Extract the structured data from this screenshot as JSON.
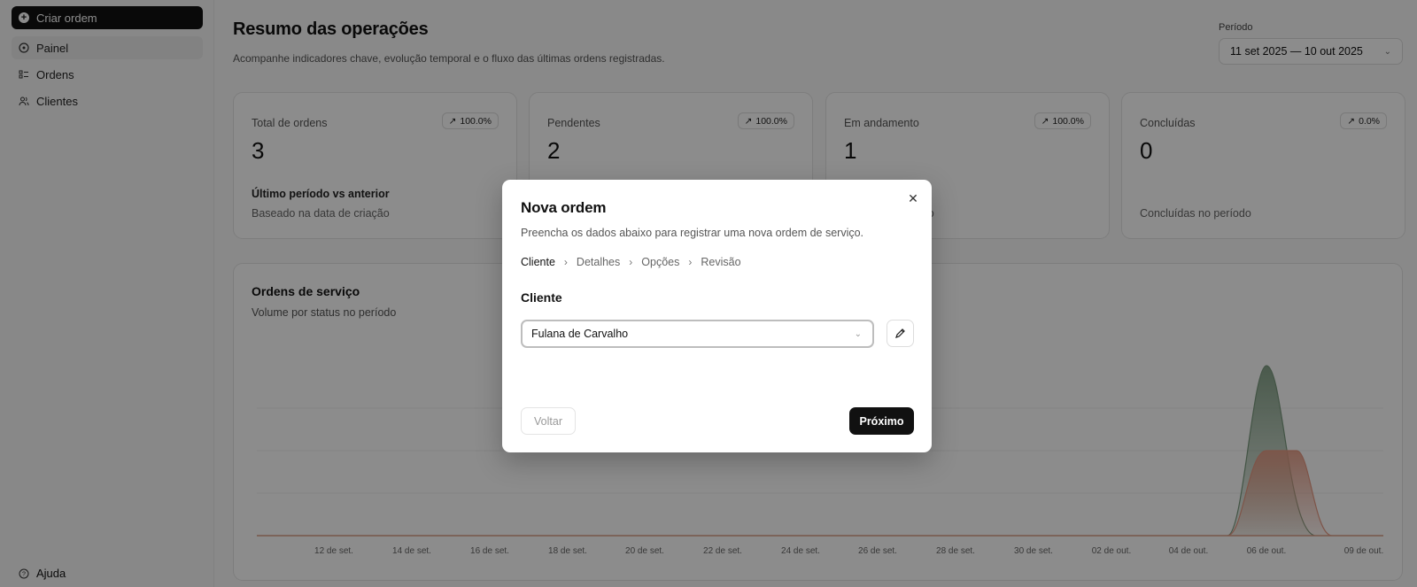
{
  "sidebar": {
    "create_label": "Criar ordem",
    "items": [
      {
        "label": "Painel",
        "icon": "dashboard-icon"
      },
      {
        "label": "Ordens",
        "icon": "list-icon"
      },
      {
        "label": "Clientes",
        "icon": "users-icon"
      }
    ],
    "help_label": "Ajuda"
  },
  "header": {
    "title": "Resumo das operações",
    "subtitle": "Acompanhe indicadores chave, evolução temporal e o fluxo das últimas ordens registradas.",
    "period_label": "Período",
    "period_value": "11 set 2025 — 10 out 2025"
  },
  "cards": [
    {
      "label": "Total de ordens",
      "value": "3",
      "badge": "100.0%",
      "foot1": "Último período vs anterior",
      "foot2": "Baseado na data de criação"
    },
    {
      "label": "Pendentes",
      "value": "2",
      "badge": "100.0%",
      "foot1": "",
      "foot2": ""
    },
    {
      "label": "Em andamento",
      "value": "1",
      "badge": "100.0%",
      "foot1": "",
      "foot2": "amento"
    },
    {
      "label": "Concluídas",
      "value": "0",
      "badge": "0.0%",
      "foot1": "",
      "foot2": "Concluídas no período"
    }
  ],
  "chart": {
    "title": "Ordens de serviço",
    "subtitle": "Volume por status no período"
  },
  "chart_data": {
    "type": "area",
    "x": [
      "12 de set.",
      "14 de set.",
      "16 de set.",
      "18 de set.",
      "20 de set.",
      "22 de set.",
      "24 de set.",
      "26 de set.",
      "28 de set.",
      "30 de set.",
      "02 de out.",
      "04 de out.",
      "06 de out.",
      "09 de out."
    ],
    "series": [
      {
        "color": "#7a9a7e",
        "peak_date": "06 de out.",
        "peak_value": 2
      },
      {
        "color": "#e59a83",
        "peak_date": "06 de out.",
        "peak_value": 1
      }
    ],
    "ylim": [
      0,
      2
    ],
    "grid": true
  },
  "modal": {
    "title": "Nova ordem",
    "subtitle": "Preencha os dados abaixo para registrar uma nova ordem de serviço.",
    "steps": [
      "Cliente",
      "Detalhes",
      "Opções",
      "Revisão"
    ],
    "field_label": "Cliente",
    "client_value": "Fulana de Carvalho",
    "back_label": "Voltar",
    "next_label": "Próximo"
  }
}
